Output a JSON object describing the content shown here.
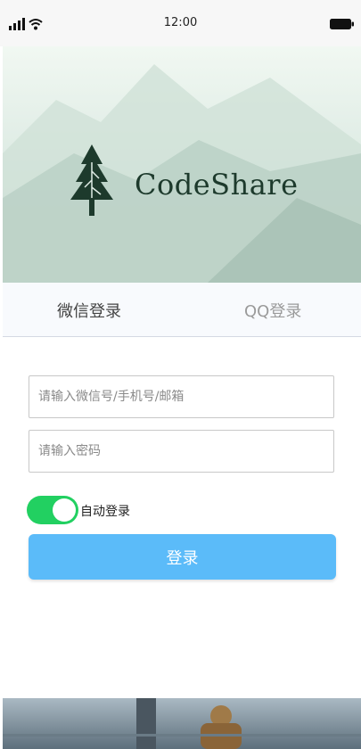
{
  "status_bar": {
    "time": "12:00",
    "icons": [
      "signal-icon",
      "wifi-icon",
      "battery-icon"
    ]
  },
  "banner": {
    "logo_text": "CodeShare",
    "logo_icon": "tree-icon"
  },
  "tabs": [
    {
      "label": "微信登录",
      "active": true
    },
    {
      "label": "QQ登录",
      "active": false
    }
  ],
  "form": {
    "account_placeholder": "请输入微信号/手机号/邮箱",
    "password_placeholder": "请输入密码",
    "auto_login_label": "自动登录",
    "auto_login_enabled": true,
    "login_button": "登录"
  },
  "colors": {
    "toggle_on": "#22d061",
    "login_button": "#5bbbf9",
    "logo": "#1d3a2c"
  }
}
